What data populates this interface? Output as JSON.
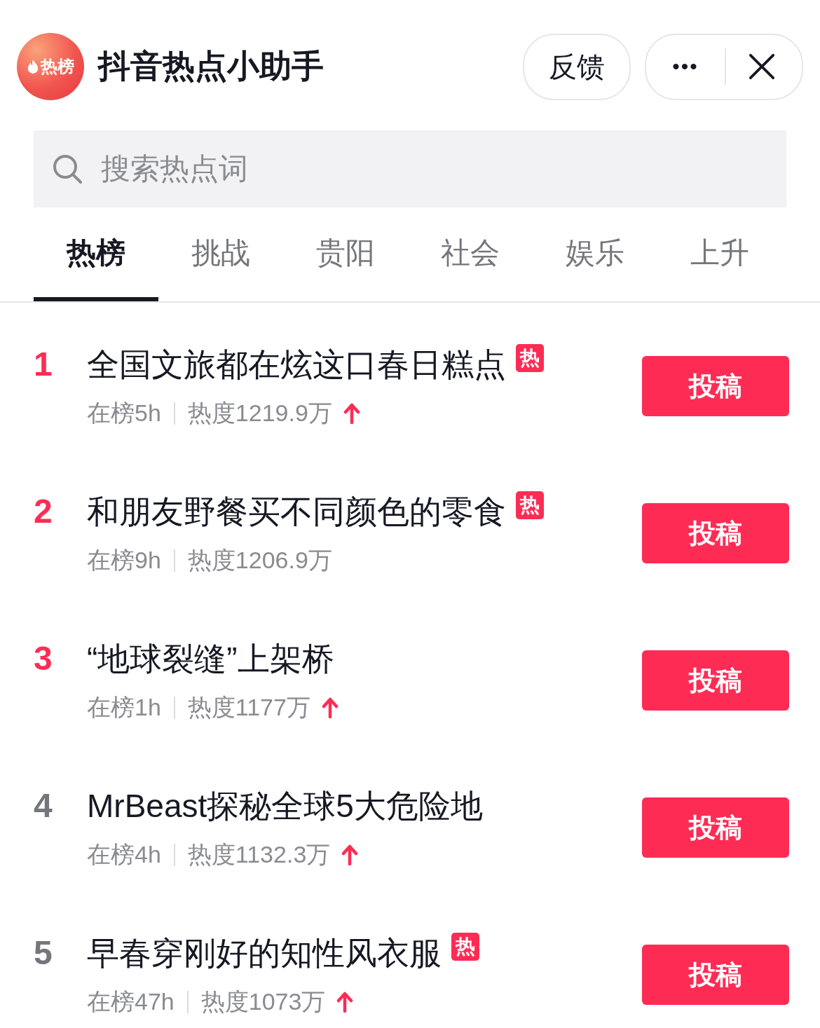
{
  "header": {
    "logo_text": "热榜",
    "title": "抖音热点小助手",
    "feedback_button": "反馈",
    "more_button": "•••"
  },
  "search": {
    "placeholder": "搜索热点词"
  },
  "tabs": [
    {
      "label": "热榜",
      "selected": true
    },
    {
      "label": "挑战",
      "selected": false
    },
    {
      "label": "贵阳",
      "selected": false
    },
    {
      "label": "社会",
      "selected": false
    },
    {
      "label": "娱乐",
      "selected": false
    },
    {
      "label": "上升",
      "selected": false
    }
  ],
  "items": [
    {
      "rank": "1",
      "top": true,
      "title": "全国文旅都在炫这口春日糕点",
      "badge": "热",
      "on_list": "在榜5h",
      "heat": "热度1219.9万",
      "rising": true,
      "button": "投稿"
    },
    {
      "rank": "2",
      "top": true,
      "title": "和朋友野餐买不同颜色的零食",
      "badge": "热",
      "on_list": "在榜9h",
      "heat": "热度1206.9万",
      "rising": false,
      "button": "投稿"
    },
    {
      "rank": "3",
      "top": true,
      "title": "“地球裂缝”上架桥",
      "on_list": "在榜1h",
      "heat": "热度1177万",
      "rising": true,
      "button": "投稿"
    },
    {
      "rank": "4",
      "top": false,
      "title": "MrBeast探秘全球5大危险地",
      "on_list": "在榜4h",
      "heat": "热度1132.3万",
      "rising": true,
      "button": "投稿"
    },
    {
      "rank": "5",
      "top": false,
      "title": "早春穿刚好的知性风衣服",
      "badge": "热",
      "on_list": "在榜47h",
      "heat": "热度1073万",
      "rising": true,
      "button": "投稿"
    }
  ]
}
